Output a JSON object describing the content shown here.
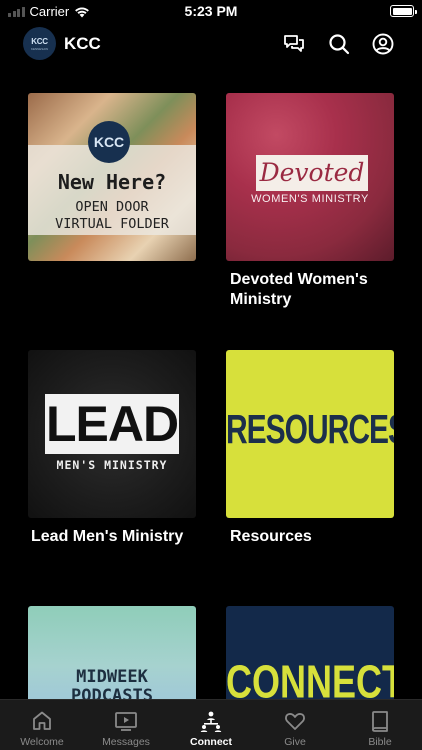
{
  "status_bar": {
    "carrier": "Carrier",
    "time": "5:23 PM"
  },
  "header": {
    "logo_text": "KCC",
    "logo_subtext": "KENNESAW",
    "title": "KCC"
  },
  "tiles": [
    {
      "caption": "",
      "art": {
        "logo": "KCC",
        "line1": "New Here?",
        "line2": "OPEN DOOR",
        "line3": "VIRTUAL FOLDER"
      }
    },
    {
      "caption": "Devoted Women's Ministry",
      "art": {
        "line1": "Devoted",
        "line2": "WOMEN'S MINISTRY"
      }
    },
    {
      "caption": "Lead Men's Ministry",
      "art": {
        "line1": "LEAD",
        "line2": "MEN'S MINISTRY"
      }
    },
    {
      "caption": "Resources",
      "art": {
        "line1": "RESOURCES"
      }
    },
    {
      "caption": "",
      "art": {
        "line1": "MIDWEEK",
        "line2": "PODCASTS"
      }
    },
    {
      "caption": "",
      "art": {
        "line1": "CONNECT"
      }
    }
  ],
  "tabbar": {
    "active": "Connect",
    "items": [
      {
        "label": "Welcome",
        "icon": "home-icon"
      },
      {
        "label": "Messages",
        "icon": "play-screen-icon"
      },
      {
        "label": "Connect",
        "icon": "people-network-icon"
      },
      {
        "label": "Give",
        "icon": "heart-icon"
      },
      {
        "label": "Bible",
        "icon": "book-icon"
      }
    ]
  },
  "colors": {
    "background": "#000000",
    "tabbar_bg": "#1b1b1b",
    "tab_inactive": "#8a8a8a",
    "tab_active": "#ffffff",
    "resources_bg": "#d7e03b",
    "connect_bg": "#13294a"
  }
}
